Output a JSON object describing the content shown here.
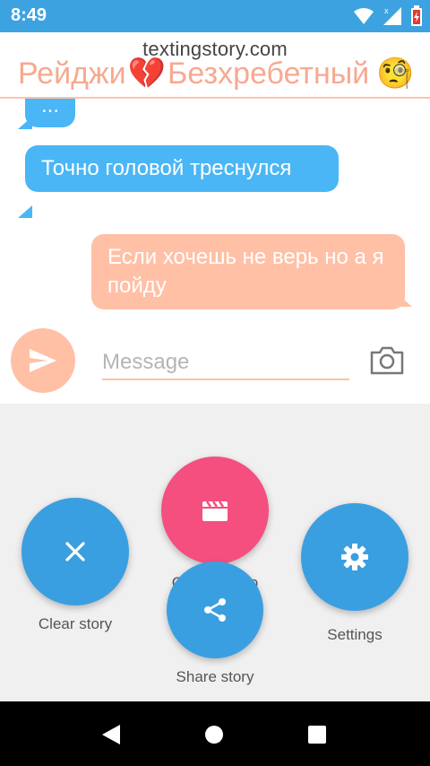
{
  "status": {
    "time": "8:49"
  },
  "header": {
    "watermark": "textingstory.com",
    "contact_name_part1": "Рейджи",
    "contact_name_part2": "Безхребетный",
    "heart_emoji": "💔",
    "contact_emoji": "🧐"
  },
  "chat": {
    "messages": [
      {
        "side": "left",
        "text": "..."
      },
      {
        "side": "left",
        "text": "Точно головой треснулся"
      },
      {
        "side": "right",
        "text": "Если хочешь не верь но а я пойду"
      }
    ]
  },
  "composer": {
    "placeholder": "Message"
  },
  "menu": {
    "clear_label": "Clear story",
    "create_label": "Create video",
    "share_label": "Share story",
    "settings_label": "Settings"
  },
  "colors": {
    "status_bar": "#3da3e0",
    "left_bubble": "#4bb6f5",
    "right_bubble": "#ffc0a6",
    "fab_blue": "#3a9fe0",
    "fab_pink": "#f44f7f"
  }
}
